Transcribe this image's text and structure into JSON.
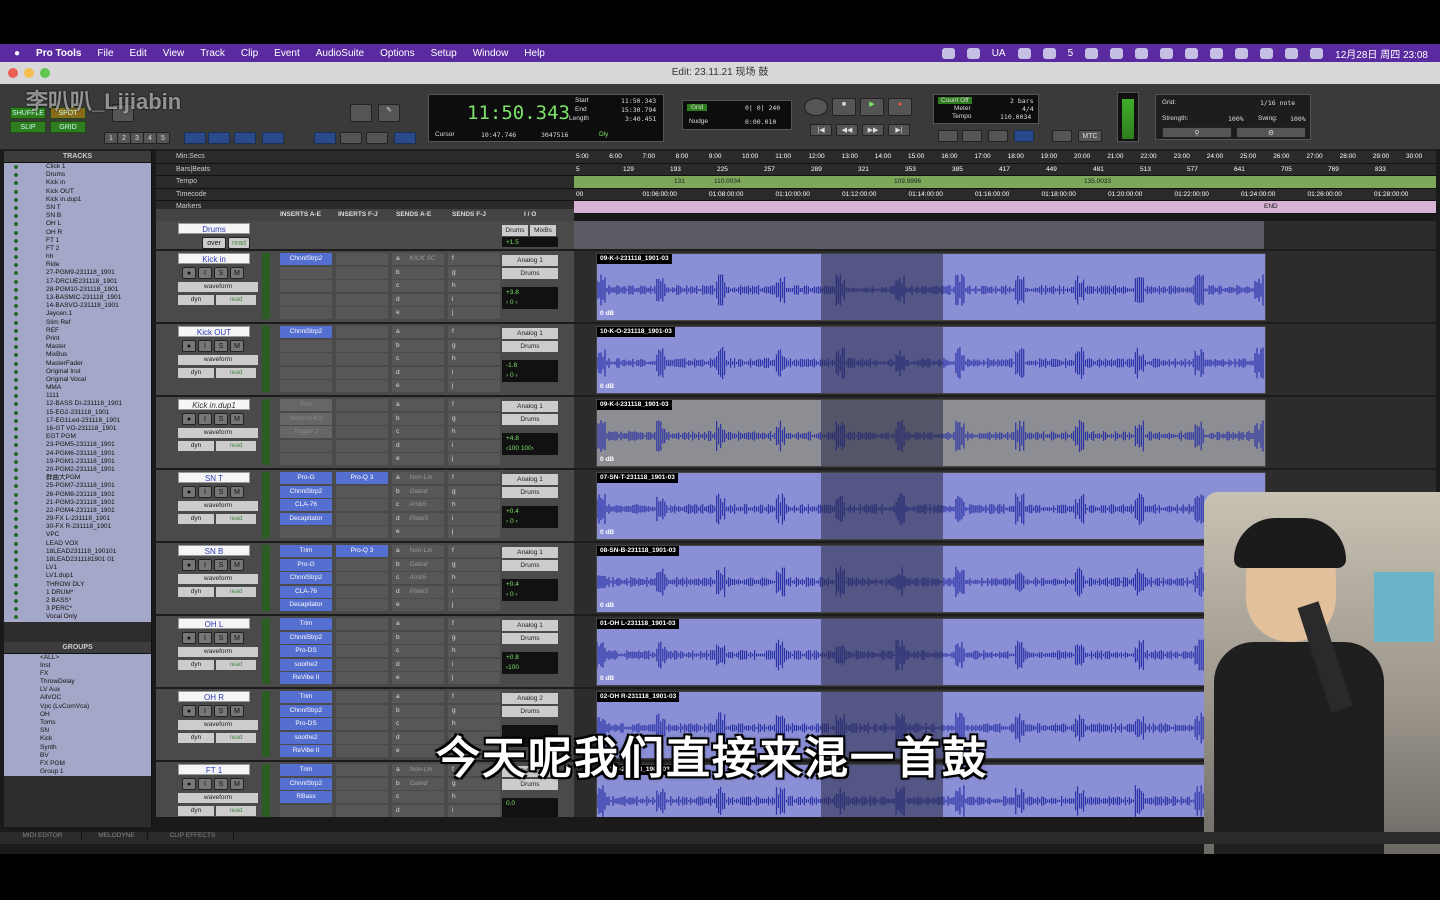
{
  "menubar": {
    "app": "Pro Tools",
    "items": [
      "File",
      "Edit",
      "View",
      "Track",
      "Clip",
      "Event",
      "AudioSuite",
      "Options",
      "Setup",
      "Window",
      "Help"
    ],
    "status_ua": "UA",
    "status_num": "5",
    "date_time": "12月28日 周四 23:08"
  },
  "window": {
    "title": "Edit: 23.11.21 现场 鼓"
  },
  "watermark": "李叭叭_Lijiabin",
  "toolbar": {
    "modes": [
      "SHUFFLE",
      "SPOT",
      "SLIP",
      "GRID"
    ],
    "zoom_presets": [
      "1",
      "2",
      "3",
      "4",
      "5"
    ]
  },
  "counter": {
    "main": "11:50.343",
    "start_label": "Start",
    "start": "11:50.343",
    "end_label": "End",
    "end": "15:30.794",
    "length_label": "Length",
    "length": "3:40.451",
    "cursor_label": "Cursor",
    "cursor": "10:47.746",
    "cursor_samples": "3047516",
    "dly_label": "Dly"
  },
  "grid_nudge": {
    "grid_label": "Grid",
    "grid_value": "0| 0| 240",
    "nudge_label": "Nudge",
    "nudge_value": "0:00.010"
  },
  "tempo_panel": {
    "count_off": "Count Off",
    "count_val": "2 bars",
    "meter_label": "Meter",
    "meter": "4/4",
    "tempo_label": "Tempo",
    "tempo": "110.0034",
    "mtc": "MTC"
  },
  "grid_panel": {
    "grid_label": "Grid:",
    "grid_value": "1/16 note",
    "strength_label": "Strength:",
    "strength": "100%",
    "swing_label": "Swing:",
    "swing": "100%"
  },
  "rulers": {
    "labels": [
      "Min:Secs",
      "Bars|Beats",
      "Tempo",
      "Timecode",
      "Markers"
    ],
    "minsecs": [
      "5:00",
      "6:00",
      "7:00",
      "8:00",
      "9:00",
      "10:00",
      "11:00",
      "12:00",
      "13:00",
      "14:00",
      "15:00",
      "16:00",
      "17:00",
      "18:00",
      "19:00",
      "20:00",
      "21:00",
      "22:00",
      "23:00",
      "24:00",
      "25:00",
      "26:00",
      "27:00",
      "28:00",
      "29:00",
      "30:00"
    ],
    "bars": [
      "5",
      "129",
      "193",
      "225",
      "257",
      "289",
      "321",
      "353",
      "385",
      "417",
      "449",
      "481",
      "513",
      "577",
      "641",
      "705",
      "769",
      "833"
    ],
    "tempos": [
      "131",
      "110.0034",
      "109.9996",
      "135.0033"
    ],
    "timecodes": [
      "00",
      "01:06:00:00",
      "01:08:00:00",
      "01:10:00:00",
      "01:12:00:00",
      "01:14:00:00",
      "01:16:00:00",
      "01:18:00:00",
      "01:20:00:00",
      "01:22:00:00",
      "01:24:00:00",
      "01:26:00:00",
      "01:28:00:00",
      "01:30:"
    ],
    "marker_end": "END"
  },
  "columns": [
    "INSERTS A-E",
    "INSERTS F-J",
    "SENDS A-E",
    "SENDS F-J",
    "I / O"
  ],
  "tracks_panel": {
    "header": "TRACKS",
    "items": [
      "Click 1",
      "Drums",
      "Kick in",
      "Kick OUT",
      "Kick in.dup1",
      "SN T",
      "SN B",
      "OH L",
      "OH R",
      "FT 1",
      "FT 2",
      "hh",
      "Ride",
      "27-PGM9-231118_1901",
      "17-DRCUE231118_1901",
      "28-PGM10-231118_1901",
      "13-BASMIC-231118_1901",
      "14-BASVO-231118_1901",
      "Jaycen.1",
      "Slim Ref",
      "REF",
      "Print",
      "Master",
      "MixBus",
      "MasterFader",
      "Original Inst",
      "Original Vocal",
      "MMA",
      "1111",
      "12-BASS DI-231118_1901",
      "15-EG2-231118_1901",
      "17-EG1Led-231118_1901",
      "16-GT VO-231118_1901",
      "EGT PGM",
      "23-PGM5-231118_1901",
      "24-PGM6-231118_1901",
      "19-PGM1-231118_1901",
      "20-PGM2-231118_1901",
      "群曲大PGM",
      "25-PGM7-231118_1901",
      "26-PGM8-231118_1901",
      "21-PGM3-231118_1901",
      "22-PGM4-231118_1901",
      "29-FX L-231118_1901",
      "30-FX R-231118_1901",
      "VPC",
      "LEAD VOX",
      "18LEAD231118_190101",
      "18LEAD2311181901 01",
      "LV1",
      "LV1.dup1",
      "THROW DLY",
      "1 DRUM*",
      "2 BASS*",
      "3 PERC*",
      "Vocal Only"
    ]
  },
  "groups_panel": {
    "header": "GROUPS",
    "items": [
      "<ALL>",
      "Inst",
      "FX",
      "ThrowDelay",
      "LV Aux",
      "AllVOC",
      "Vpc (LvComVca)",
      "OH",
      "Toms",
      "SN",
      "Kick",
      "Synth",
      "BV",
      "FX PGM",
      "Group 1"
    ]
  },
  "drums_folder": {
    "name": "Drums",
    "io_a": "Drums",
    "io_b": "MixBs",
    "vol": "+1.5",
    "mode": "over",
    "rd": "read"
  },
  "tracks": [
    {
      "name": "Kick in",
      "view": "waveform",
      "dyn": "dyn",
      "auto": "read",
      "inserts": [
        "ChnnlStrp2"
      ],
      "sends": [],
      "send_labels": [
        "KICK SC"
      ],
      "io_in": "Analog 1",
      "io_out": "Drums",
      "vol": "+3.8",
      "pan": "› 0 ‹",
      "clip": "09-K-I-231118_1901-03",
      "gain": "0 dB"
    },
    {
      "name": "Kick OUT",
      "view": "waveform",
      "dyn": "dyn",
      "auto": "read",
      "inserts": [
        "ChnnlStrp2"
      ],
      "sends": [],
      "send_labels": [],
      "io_in": "Analog 1",
      "io_out": "Drums",
      "vol": "-1.8",
      "pan": "› 0 ‹",
      "clip": "10-K-O-231118_1901-03",
      "gain": "0 dB"
    },
    {
      "name": "Kick in.dup1",
      "view": "waveform",
      "dyn": "dyn",
      "auto": "read",
      "inserts": [
        "Trim",
        "Neutron4Gt",
        "Trigger 2"
      ],
      "sends": [],
      "send_labels": [],
      "io_in": "Analog 1",
      "io_out": "Drums",
      "vol": "+4.8",
      "pan": "‹100  100›",
      "clip": "09-K-I-231118_1901-03",
      "gain": "0 dB",
      "inactive": true
    },
    {
      "name": "SN T",
      "view": "waveform",
      "dyn": "dyn",
      "auto": "read",
      "inserts": [
        "Pro-G",
        "ChnnlStrp2",
        "CLA-76",
        "Decapitator"
      ],
      "inserts_b": [
        "Pro-Q 3"
      ],
      "send_labels": [
        "Non-Lin",
        "Gated",
        "Amb5",
        "Plate5"
      ],
      "io_in": "Analog 1",
      "io_out": "Drums",
      "vol": "+0.4",
      "pan": "› 0 ‹",
      "clip": "07-SN-T-231118_1901-03",
      "gain": "0 dB"
    },
    {
      "name": "SN B",
      "view": "waveform",
      "dyn": "dyn",
      "auto": "read",
      "inserts": [
        "Trim",
        "Pro-G",
        "ChnnlStrp2",
        "CLA-76",
        "Decapitator"
      ],
      "inserts_b": [
        "Pro-Q 3"
      ],
      "send_labels": [
        "Non-Lin",
        "Gated",
        "Amb5",
        "Plate5"
      ],
      "io_in": "Analog 1",
      "io_out": "Drums",
      "vol": "+0.4",
      "pan": "› 0 ‹",
      "clip": "08-SN-B-231118_1901-03",
      "gain": "0 dB"
    },
    {
      "name": "OH L",
      "view": "waveform",
      "dyn": "dyn",
      "auto": "read",
      "inserts": [
        "Trim",
        "ChnnlStrp2",
        "Pro-DS",
        "soothe2",
        "ReVibe II"
      ],
      "send_labels": [],
      "io_in": "Analog 1",
      "io_out": "Drums",
      "vol": "+0.8",
      "pan": "‹100",
      "clip": "01-OH L-231118_1901-03",
      "gain": "0 dB"
    },
    {
      "name": "OH R",
      "view": "waveform",
      "dyn": "dyn",
      "auto": "read",
      "inserts": [
        "Trim",
        "ChnnlStrp2",
        "Pro-DS",
        "soothe2",
        "ReVibe II"
      ],
      "send_labels": [],
      "io_in": "Analog 2",
      "io_out": "Drums",
      "vol": "",
      "pan": "",
      "clip": "02-OH R-231118_1901-03",
      "gain": ""
    },
    {
      "name": "FT 1",
      "view": "waveform",
      "dyn": "dyn",
      "auto": "read",
      "inserts": [
        "Trim",
        "ChnnlStrp2",
        "RBass"
      ],
      "send_labels": [
        "Non-Lin",
        "Gated"
      ],
      "io_in": "SPDIF L/R L",
      "io_out": "Drums",
      "vol": "0.0",
      "pan": "",
      "clip": "05-F-T-231118_1901-03",
      "gain": ""
    }
  ],
  "send_letters": [
    "a",
    "b",
    "c",
    "d",
    "e"
  ],
  "send_letters_fj": [
    "f",
    "g",
    "h",
    "i",
    "j"
  ],
  "bottom_tabs": [
    "MIDI EDITOR",
    "MELODYNE",
    "CLIP EFFECTS"
  ],
  "subtitle": "今天呢我们直接来混一首鼓",
  "colors": {
    "menubar": "#5a2aa0",
    "clip": "#8a8fd6",
    "counter_green": "#7de36a",
    "track_name": "#2d3bb8"
  }
}
